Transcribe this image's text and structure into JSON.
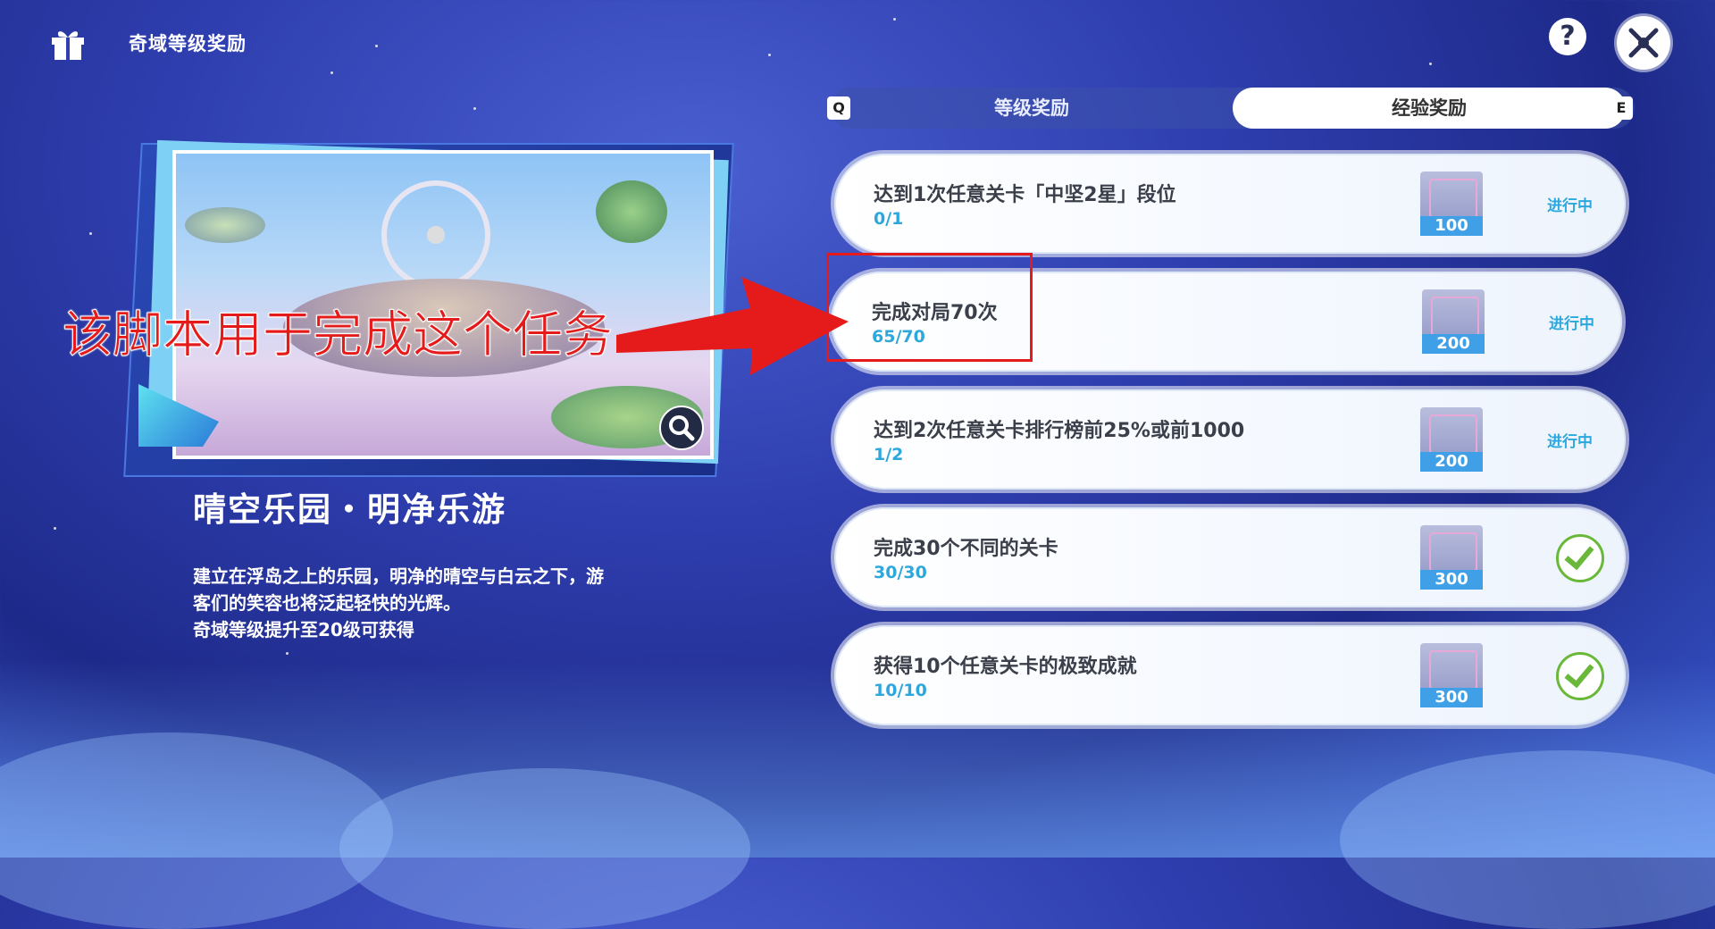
{
  "header": {
    "title": "奇域等级奖励",
    "help_label": "?"
  },
  "tabs": [
    {
      "label": "等级奖励",
      "key": "Q",
      "active": false
    },
    {
      "label": "经验奖励",
      "key": "E",
      "active": true
    }
  ],
  "reward": {
    "name": "晴空乐园・明净乐游",
    "description_line1": "建立在浮岛之上的乐园，明净的晴空与白云之下，游",
    "description_line2": "客们的笑容也将泛起轻快的光辉。",
    "description_line3": "奇域等级提升至20级可获得"
  },
  "annotation": {
    "text": "该脚本用于完成这个任务",
    "color": "#e51b1b"
  },
  "tasks": [
    {
      "title": "达到1次任意关卡「中坚2星」段位",
      "progress": "0/1",
      "exp": "100",
      "status": "进行中",
      "done": false
    },
    {
      "title": "完成对局70次",
      "progress": "65/70",
      "exp": "200",
      "status": "进行中",
      "done": false
    },
    {
      "title": "达到2次任意关卡排行榜前25%或前1000",
      "progress": "1/2",
      "exp": "200",
      "status": "进行中",
      "done": false
    },
    {
      "title": "完成30个不同的关卡",
      "progress": "30/30",
      "exp": "300",
      "status": "",
      "done": true
    },
    {
      "title": "获得10个任意关卡的极致成就",
      "progress": "10/10",
      "exp": "300",
      "status": "",
      "done": true
    }
  ],
  "colors": {
    "accent": "#2ea7dc",
    "check": "#69b83a",
    "background": "#2f3fb0"
  }
}
